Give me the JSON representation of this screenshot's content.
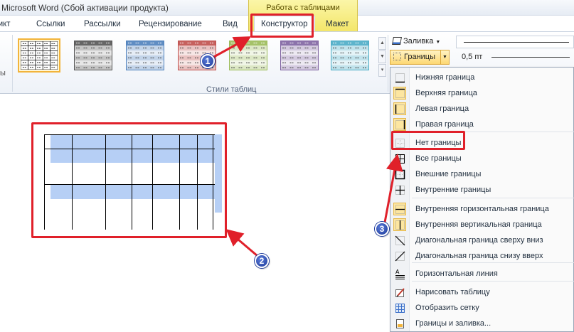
{
  "window": {
    "title": "Microsoft Word (Сбой активации продукта)",
    "context_group_label": "Работа с таблицами"
  },
  "tabs": [
    {
      "label": "дикт",
      "active": false
    },
    {
      "label": "Ссылки",
      "active": false
    },
    {
      "label": "Рассылки",
      "active": false
    },
    {
      "label": "Рецензирование",
      "active": false
    },
    {
      "label": "Вид",
      "active": false
    },
    {
      "label": "Конструктор",
      "active": true
    },
    {
      "label": "Макет",
      "active": false
    }
  ],
  "ribbon": {
    "left_stub": "ы",
    "group_label": "Стили таблиц",
    "fill_label": "Заливка",
    "borders_label": "Границы",
    "pen_weight": "0,5 пт",
    "style_colors": [
      "#000000",
      "#555555",
      "#4f81bd",
      "#c0504d",
      "#9bbb59",
      "#8064a2",
      "#4bacc6"
    ]
  },
  "menu": {
    "items": [
      {
        "label": "Нижняя граница",
        "icon": "border-bottom-icon",
        "highlight": false
      },
      {
        "label": "Верхняя граница",
        "icon": "border-top-icon",
        "highlight": true
      },
      {
        "label": "Левая граница",
        "icon": "border-left-icon",
        "highlight": true
      },
      {
        "label": "Правая граница",
        "icon": "border-right-icon",
        "highlight": true
      },
      {
        "label": "Нет границы",
        "icon": "no-border-icon",
        "highlight": false
      },
      {
        "label": "Все границы",
        "icon": "all-borders-icon",
        "highlight": false
      },
      {
        "label": "Внешние границы",
        "icon": "outside-borders-icon",
        "highlight": false
      },
      {
        "label": "Внутренние границы",
        "icon": "inside-borders-icon",
        "highlight": false
      },
      {
        "label": "Внутренняя горизонтальная граница",
        "icon": "inside-horizontal-border-icon",
        "highlight": true
      },
      {
        "label": "Внутренняя вертикальная граница",
        "icon": "inside-vertical-border-icon",
        "highlight": true
      },
      {
        "label": "Диагональная граница сверху вниз",
        "icon": "diagonal-down-border-icon",
        "highlight": false
      },
      {
        "label": "Диагональная граница снизу вверх",
        "icon": "diagonal-up-border-icon",
        "highlight": false
      },
      {
        "label": "Горизонтальная линия",
        "icon": "horizontal-line-icon",
        "highlight": false
      },
      {
        "label": "Нарисовать таблицу",
        "icon": "draw-table-icon",
        "highlight": false
      },
      {
        "label": "Отобразить сетку",
        "icon": "view-gridlines-icon",
        "highlight": false
      },
      {
        "label": "Границы и заливка...",
        "icon": "borders-shading-icon",
        "highlight": false
      }
    ]
  },
  "markers": [
    "1",
    "2",
    "3"
  ]
}
